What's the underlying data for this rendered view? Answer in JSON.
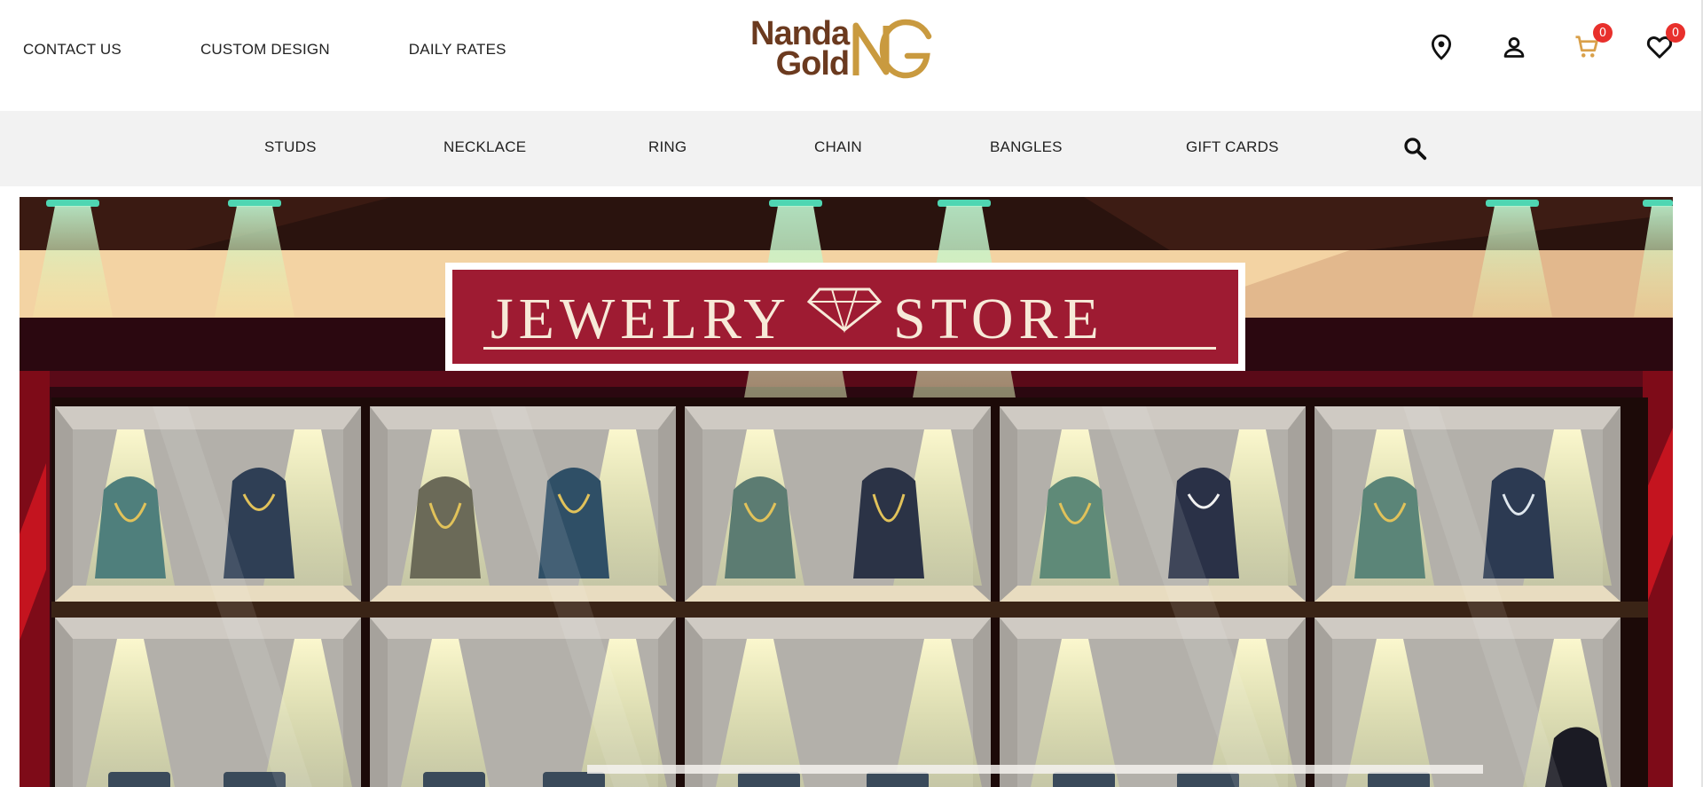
{
  "header": {
    "links": [
      {
        "label": "CONTACT US"
      },
      {
        "label": "CUSTOM DESIGN"
      },
      {
        "label": "DAILY RATES"
      }
    ],
    "logo": {
      "line1": "Nanda",
      "line2": "Gold",
      "mark": "NG"
    },
    "icons": [
      {
        "name": "location-icon"
      },
      {
        "name": "account-icon"
      },
      {
        "name": "cart-icon",
        "count": "0"
      },
      {
        "name": "wishlist-icon",
        "count": "0"
      }
    ]
  },
  "nav": {
    "items": [
      {
        "label": "STUDS"
      },
      {
        "label": "NECKLACE"
      },
      {
        "label": "RING"
      },
      {
        "label": "CHAIN"
      },
      {
        "label": "BANGLES"
      },
      {
        "label": "GIFT CARDS"
      }
    ],
    "search_icon": "search-icon"
  },
  "hero": {
    "sign_text": "JEWELRY STORE",
    "sign_left": "JEWELRY",
    "sign_right": "STORE"
  },
  "colors": {
    "brand_brown": "#6b3a1f",
    "brand_gold": "#c99a3f",
    "badge_red": "#e8302c",
    "nav_bg": "#f2f2f2",
    "sign_red": "#9e1b32"
  }
}
